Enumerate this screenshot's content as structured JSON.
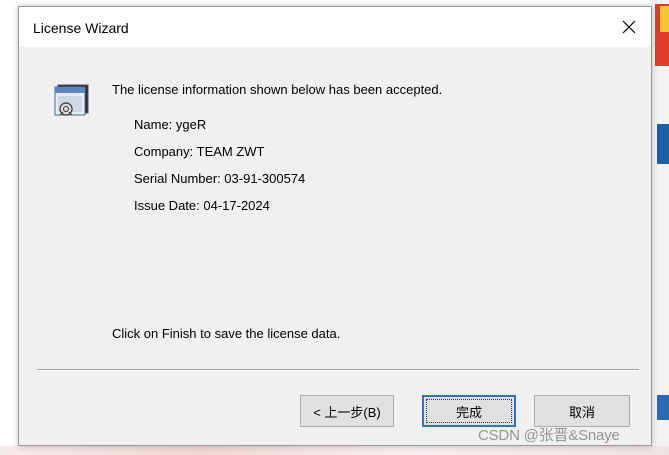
{
  "window": {
    "title": "License Wizard",
    "close_glyph": "✕"
  },
  "content": {
    "icon": "license-key-icon",
    "accepted_message": "The license information shown below has been accepted.",
    "details": [
      {
        "text": "Name: ygeR"
      },
      {
        "text": "Company: TEAM ZWT"
      },
      {
        "text": "Serial Number: 03-91-300574"
      },
      {
        "text": "Issue Date: 04-17-2024"
      }
    ],
    "finish_note": "Click on Finish to save the license data."
  },
  "buttons": {
    "back_label": "< 上一步(B)",
    "finish_label": "完成",
    "cancel_label": "取消"
  },
  "watermark": "CSDN @张晋&Snaye",
  "colors": {
    "dialog_bg": "#f0f0f0",
    "titlebar_bg": "#ffffff",
    "focus_border": "#2c73c9"
  }
}
